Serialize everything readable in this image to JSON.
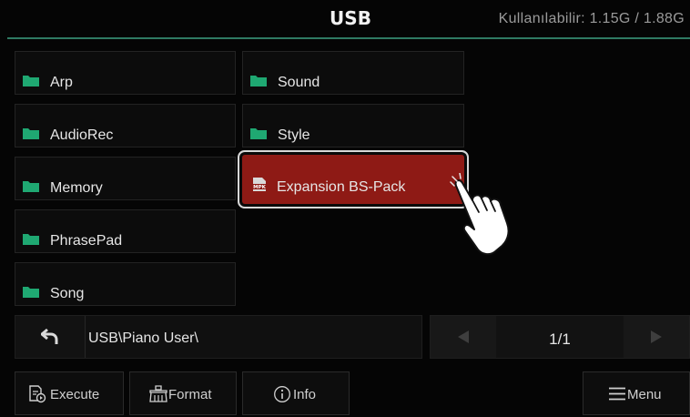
{
  "header": {
    "title": "USB",
    "space": "Kullanılabilir: 1.15G / 1.88G"
  },
  "files": [
    {
      "label": "Arp",
      "icon": "folder-icon"
    },
    {
      "label": "AudioRec",
      "icon": "folder-icon"
    },
    {
      "label": "Memory",
      "icon": "folder-icon"
    },
    {
      "label": "PhrasePad",
      "icon": "folder-icon"
    },
    {
      "label": "Song",
      "icon": "folder-icon"
    },
    {
      "label": "Sound",
      "icon": "folder-icon"
    },
    {
      "label": "Style",
      "icon": "folder-icon"
    },
    {
      "label": "Expansion BS-Pack",
      "icon": "mpk-file-icon",
      "selected": true
    }
  ],
  "path": {
    "text": "USB\\Piano User\\"
  },
  "pager": {
    "text": "1/1"
  },
  "buttons": {
    "execute": "Execute",
    "format": "Format",
    "info": "Info",
    "menu": "Menu"
  },
  "colors": {
    "accent_line": "#2f7a63",
    "folder_green": "#1fa872",
    "selected_tile": "#8e1a15"
  }
}
